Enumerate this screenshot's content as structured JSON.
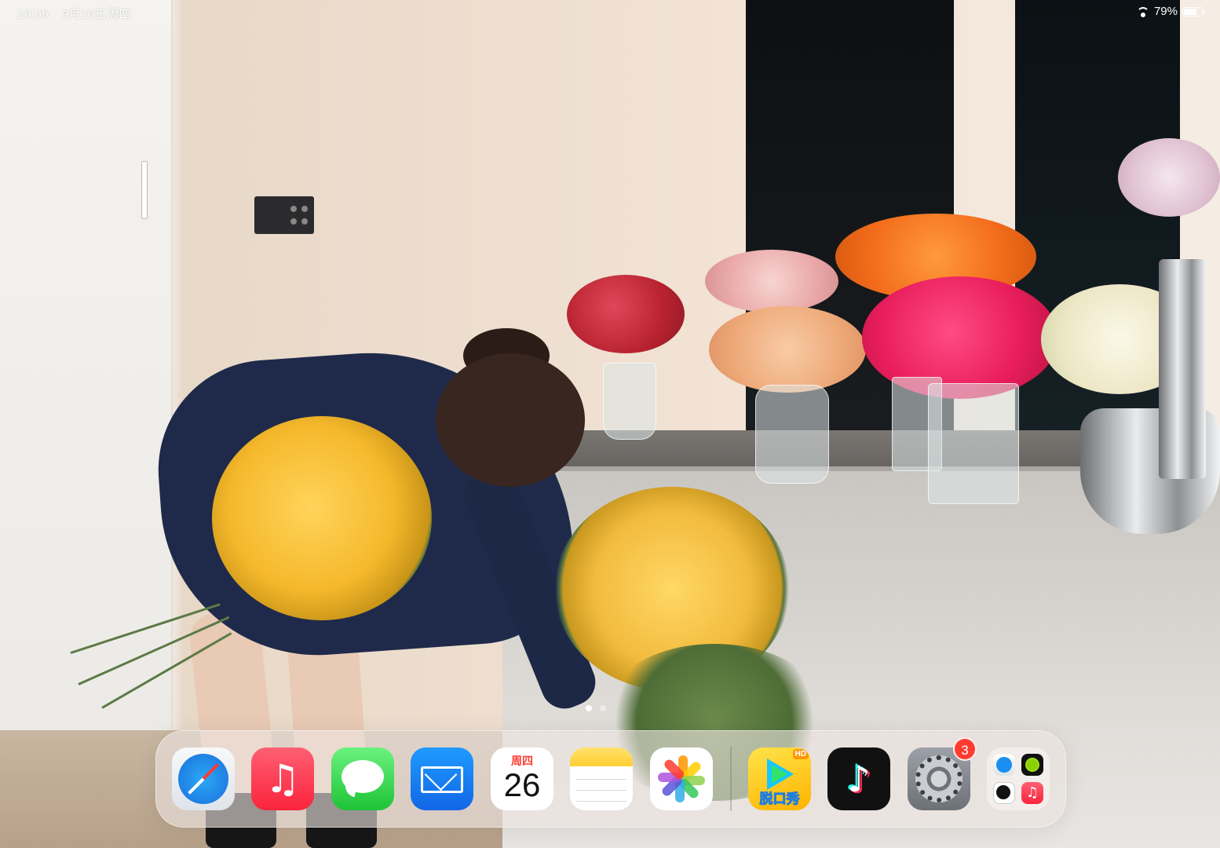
{
  "status_bar": {
    "time": "10:06",
    "date": "9月26日周四",
    "battery_percent": "79%",
    "battery_level": 0.79
  },
  "home_screen": {
    "page_count": 2,
    "current_page": 1
  },
  "dock": {
    "apps": [
      {
        "name": "Safari",
        "icon": "safari-compass-icon"
      },
      {
        "name": "Music",
        "icon": "music-note-icon"
      },
      {
        "name": "Messages",
        "icon": "speech-bubble-icon"
      },
      {
        "name": "Mail",
        "icon": "envelope-icon"
      },
      {
        "name": "Calendar",
        "icon": "calendar-icon",
        "weekday": "周四",
        "day": "26"
      },
      {
        "name": "Notes",
        "icon": "notepad-icon"
      },
      {
        "name": "Photos",
        "icon": "photos-flower-icon"
      },
      {
        "name": "腾讯视频",
        "icon": "tencent-video-icon",
        "badge_text": "HD",
        "label_text": "脱口秀"
      },
      {
        "name": "TikTok",
        "icon": "tiktok-note-icon"
      },
      {
        "name": "Settings",
        "icon": "gear-icon",
        "badge": "3"
      },
      {
        "name": "App Library",
        "icon": "app-library-icon"
      }
    ]
  },
  "colors": {
    "badge": "#ff3b30",
    "music": "#fa243c",
    "messages": "#1ec337",
    "mail": "#1266e6"
  }
}
